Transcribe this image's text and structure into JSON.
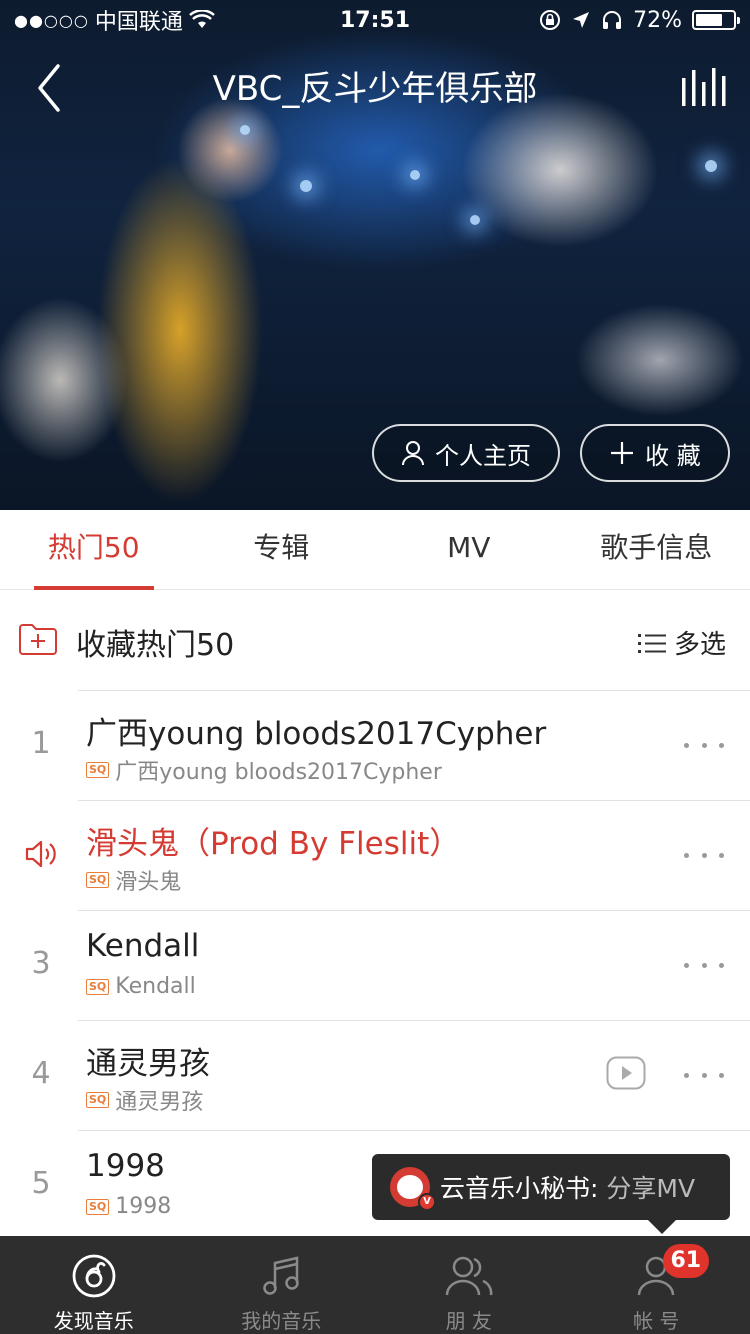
{
  "status_bar": {
    "signal": "●●○○○",
    "carrier": "中国联通",
    "time": "17:51",
    "battery": "72%",
    "battery_level": 0.72
  },
  "header": {
    "title": "VBC_反斗少年俱乐部",
    "profile_button": "个人主页",
    "collect_button": "收 藏"
  },
  "tabs": [
    {
      "label": "热门50",
      "active": true
    },
    {
      "label": "专辑",
      "active": false
    },
    {
      "label": "MV",
      "active": false
    },
    {
      "label": "歌手信息",
      "active": false
    }
  ],
  "collect_row": {
    "label": "收藏热门50",
    "multi_select": "多选"
  },
  "songs": [
    {
      "index": "1",
      "title": "广西young bloods2017Cypher",
      "album": "广西young bloods2017Cypher",
      "quality_badge": "SQ",
      "playing": false,
      "has_mv": false
    },
    {
      "index": "2",
      "title": "滑头鬼（Prod By Fleslit）",
      "album": "滑头鬼",
      "quality_badge": "SQ",
      "playing": true,
      "has_mv": false
    },
    {
      "index": "3",
      "title": "Kendall",
      "album": "Kendall",
      "quality_badge": "SQ",
      "playing": false,
      "has_mv": false
    },
    {
      "index": "4",
      "title": "通灵男孩",
      "album": "通灵男孩",
      "quality_badge": "SQ",
      "playing": false,
      "has_mv": true
    },
    {
      "index": "5",
      "title": "1998",
      "album": "1998",
      "quality_badge": "SQ",
      "playing": false,
      "has_mv": false
    }
  ],
  "toast": {
    "prefix": "云音乐小秘书:",
    "highlight": "分享MV"
  },
  "bottom_nav": [
    {
      "label": "发现音乐",
      "icon": "netease-music-icon",
      "active": true
    },
    {
      "label": "我的音乐",
      "icon": "music-note-icon",
      "active": false
    },
    {
      "label": "朋 友",
      "icon": "friends-icon",
      "active": false
    },
    {
      "label": "帐 号",
      "icon": "user-icon",
      "active": false,
      "badge": "61"
    }
  ],
  "colors": {
    "accent": "#d43c33",
    "nav_bg": "#2e2e2e",
    "sq_badge": "#e87e3a"
  }
}
